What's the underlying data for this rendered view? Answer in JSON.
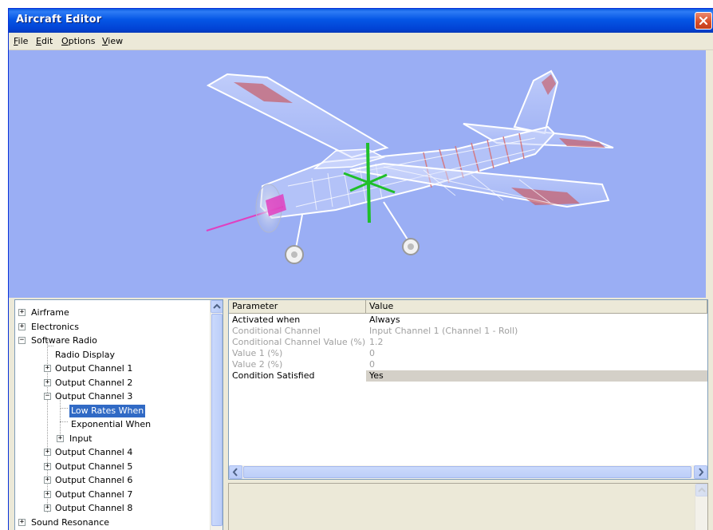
{
  "window": {
    "title": "Aircraft Editor"
  },
  "menu": [
    {
      "key": "F",
      "rest": "ile"
    },
    {
      "key": "E",
      "rest": "dit"
    },
    {
      "key": "O",
      "rest": "ptions"
    },
    {
      "key": "V",
      "rest": "iew"
    }
  ],
  "tree": {
    "items": [
      {
        "label": "Airframe",
        "expander": "+"
      },
      {
        "label": "Electronics",
        "expander": "+"
      },
      {
        "label": "Software Radio",
        "expander": "−"
      },
      {
        "label": "Radio Display",
        "expander": ""
      },
      {
        "label": "Output Channel 1",
        "expander": "+"
      },
      {
        "label": "Output Channel 2",
        "expander": "+"
      },
      {
        "label": "Output Channel 3",
        "expander": "−"
      },
      {
        "label": "Low Rates When",
        "expander": "",
        "selected": true
      },
      {
        "label": "Exponential When",
        "expander": ""
      },
      {
        "label": "Input",
        "expander": "+"
      },
      {
        "label": "Output Channel 4",
        "expander": "+"
      },
      {
        "label": "Output Channel 5",
        "expander": "+"
      },
      {
        "label": "Output Channel 6",
        "expander": "+"
      },
      {
        "label": "Output Channel 7",
        "expander": "+"
      },
      {
        "label": "Output Channel 8",
        "expander": "+"
      },
      {
        "label": "Sound Resonance",
        "expander": "+"
      }
    ]
  },
  "grid": {
    "headers": {
      "parameter": "Parameter",
      "value": "Value"
    },
    "rows": [
      {
        "parameter": "Activated when",
        "value": "Always",
        "enabled": true
      },
      {
        "parameter": "Conditional Channel",
        "value": "Input Channel 1 (Channel 1 - Roll)",
        "enabled": false
      },
      {
        "parameter": "Conditional Channel Value (%)",
        "value": "1.2",
        "enabled": false
      },
      {
        "parameter": "Value 1 (%)",
        "value": "0",
        "enabled": false
      },
      {
        "parameter": "Value 2 (%)",
        "value": "0",
        "enabled": false
      },
      {
        "parameter": "Condition Satisfied",
        "value": "Yes",
        "enabled": true,
        "highlight": true
      }
    ]
  },
  "colors": {
    "titlebar": "#0556e5",
    "viewport_bg": "#9aaef4",
    "selection": "#316ac5",
    "window_bg": "#ece9d8",
    "cg_marker": "#1fbf2a",
    "propeller_axis": "#e040c0"
  }
}
